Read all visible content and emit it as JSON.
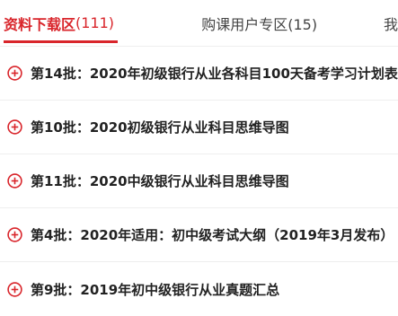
{
  "tabs": [
    {
      "label": "资料下载区",
      "count": "(111)",
      "active": true
    },
    {
      "label": "购课用户专区(15)",
      "active": false
    },
    {
      "label": "我",
      "active": false
    }
  ],
  "items": [
    {
      "label": "第14批：2020年初级银行从业各科目100天备考学习计划表",
      "icon": "plus-circle-icon"
    },
    {
      "label": "第10批：2020初级银行从业科目思维导图",
      "icon": "plus-circle-icon"
    },
    {
      "label": "第11批：2020中级银行从业科目思维导图",
      "icon": "plus-circle-icon"
    },
    {
      "label": "第4批：2020年适用：初中级考试大纲（2019年3月发布）",
      "icon": "plus-circle-icon"
    },
    {
      "label": "第9批：2019年初中级银行从业真题汇总",
      "icon": "plus-circle-icon"
    }
  ],
  "colors": {
    "accent": "#d9252b",
    "text": "#222222",
    "tab_inactive": "#444444",
    "divider": "#eeeeee"
  }
}
